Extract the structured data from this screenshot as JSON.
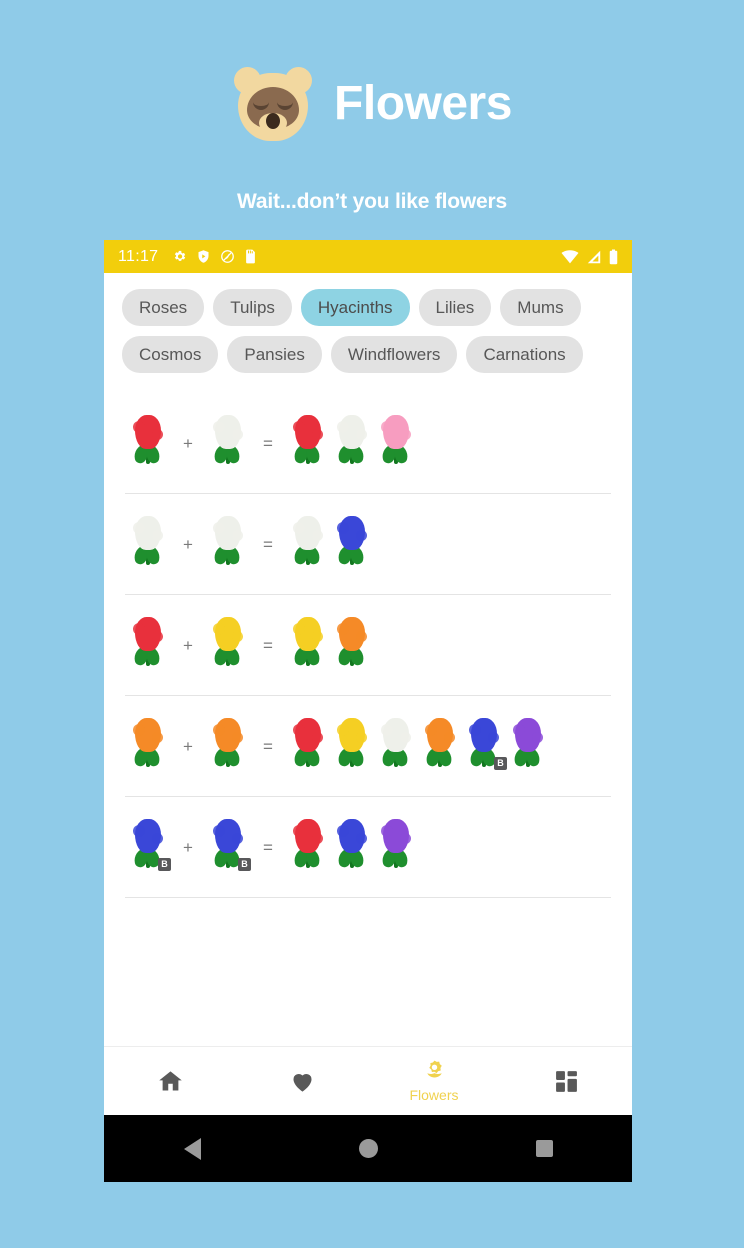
{
  "promo": {
    "title": "Flowers",
    "subtitle": "Wait...don’t you like flowers",
    "mascot_icon": "bear-face-icon",
    "background_color": "#8fcbe8"
  },
  "status_bar": {
    "time": "11:17",
    "background_color": "#f2ce0c",
    "left_icons": [
      "gear-icon",
      "shield-play-icon",
      "do-not-disturb-icon",
      "sd-card-icon"
    ],
    "right_icons": [
      "wifi-icon",
      "cellular-signal-icon",
      "battery-icon"
    ]
  },
  "chips": {
    "selected": "Hyacinths",
    "active_color": "#8ed3e3",
    "inactive_color": "#e2e2e2",
    "rows": [
      [
        "Roses",
        "Tulips",
        "Hyacinths",
        "Lilies",
        "Mums"
      ],
      [
        "Cosmos",
        "Pansies",
        "Windflowers",
        "Carnations"
      ]
    ]
  },
  "breeding": {
    "plus_symbol": "+",
    "equals_symbol": "=",
    "colors": {
      "red": "#e8303c",
      "white": "#eef0ea",
      "pink": "#f79dc0",
      "yellow": "#f5cf23",
      "orange": "#f58a27",
      "blue": "#3a47d8",
      "purple": "#8b4ad8"
    },
    "badge_label": "B",
    "rows": [
      {
        "parents": [
          {
            "color": "red",
            "badge": null
          },
          {
            "color": "white",
            "badge": null
          }
        ],
        "offspring": [
          {
            "color": "red",
            "badge": null
          },
          {
            "color": "white",
            "badge": null
          },
          {
            "color": "pink",
            "badge": null
          }
        ]
      },
      {
        "parents": [
          {
            "color": "white",
            "badge": null
          },
          {
            "color": "white",
            "badge": null
          }
        ],
        "offspring": [
          {
            "color": "white",
            "badge": null
          },
          {
            "color": "blue",
            "badge": null
          }
        ]
      },
      {
        "parents": [
          {
            "color": "red",
            "badge": null
          },
          {
            "color": "yellow",
            "badge": null
          }
        ],
        "offspring": [
          {
            "color": "yellow",
            "badge": null
          },
          {
            "color": "orange",
            "badge": null
          }
        ]
      },
      {
        "parents": [
          {
            "color": "orange",
            "badge": null
          },
          {
            "color": "orange",
            "badge": null
          }
        ],
        "offspring": [
          {
            "color": "red",
            "badge": null
          },
          {
            "color": "yellow",
            "badge": null
          },
          {
            "color": "white",
            "badge": null
          },
          {
            "color": "orange",
            "badge": null
          },
          {
            "color": "blue",
            "badge": "B"
          },
          {
            "color": "purple",
            "badge": null
          }
        ]
      },
      {
        "parents": [
          {
            "color": "blue",
            "badge": "B"
          },
          {
            "color": "blue",
            "badge": "B"
          }
        ],
        "offspring": [
          {
            "color": "red",
            "badge": null
          },
          {
            "color": "blue",
            "badge": null
          },
          {
            "color": "purple",
            "badge": null
          }
        ]
      }
    ]
  },
  "bottom_nav": {
    "active_index": 2,
    "active_color": "#f0d24f",
    "inactive_color": "#595959",
    "items": [
      {
        "icon": "home-icon",
        "label": ""
      },
      {
        "icon": "heart-icon",
        "label": ""
      },
      {
        "icon": "flower-icon",
        "label": "Flowers"
      },
      {
        "icon": "dashboard-grid-icon",
        "label": ""
      }
    ]
  },
  "android_nav": {
    "buttons": [
      "back-icon",
      "home-icon",
      "recents-icon"
    ]
  }
}
